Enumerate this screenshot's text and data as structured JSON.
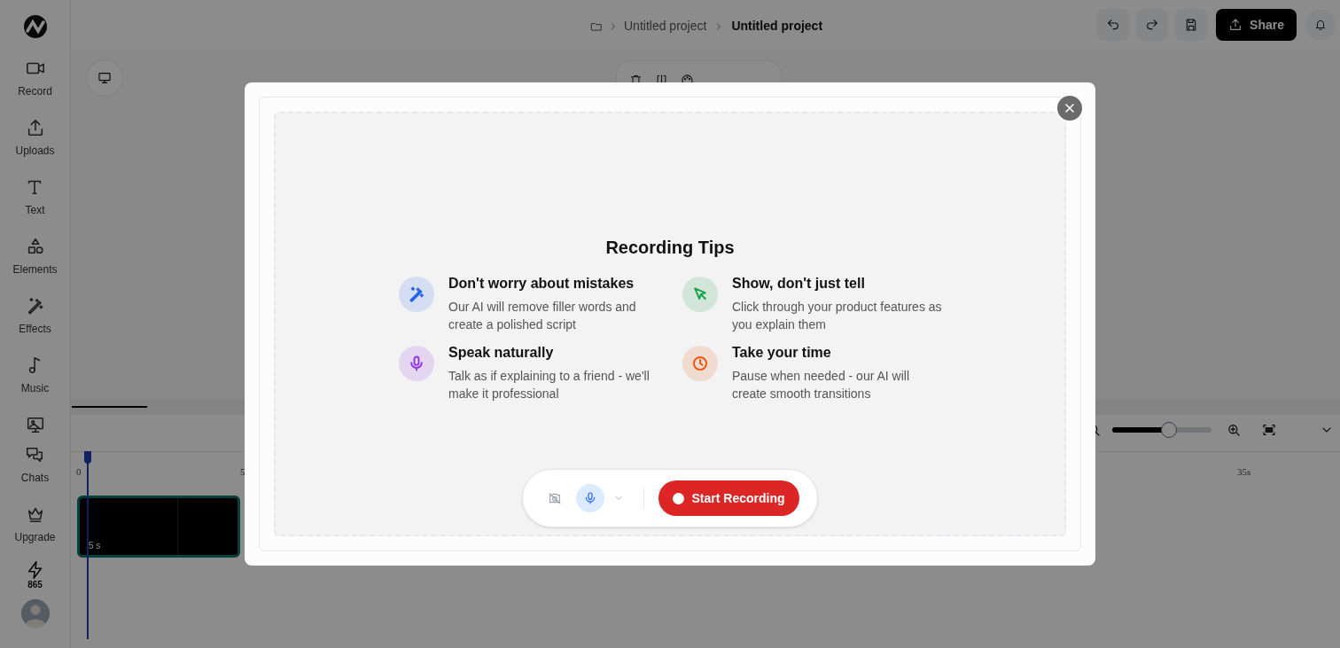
{
  "breadcrumb": [
    {
      "label": "Untitled project",
      "current": false
    },
    {
      "label": "Untitled project",
      "current": true
    }
  ],
  "share_button": "Share",
  "sidebar": {
    "items": [
      {
        "label": "Record"
      },
      {
        "label": "Uploads"
      },
      {
        "label": "Text"
      },
      {
        "label": "Elements"
      },
      {
        "label": "Effects"
      },
      {
        "label": "Music"
      },
      {
        "kind": "icon_only"
      },
      {
        "label": "Chats"
      },
      {
        "label": "Upgrade"
      }
    ],
    "credits": "865"
  },
  "timeline": {
    "zoom": {
      "level": 0.57
    },
    "ruler": [
      "0",
      "5",
      "35s"
    ],
    "clip": {
      "duration": "5 s"
    }
  },
  "modal": {
    "title": "Recording Tips",
    "tips": [
      {
        "title": "Don't worry about mistakes",
        "text": "Our AI will remove filler words and create a polished script",
        "color": "#2563eb"
      },
      {
        "title": "Show, don't just tell",
        "text": "Click through your product features as you explain them",
        "color": "#16a34a"
      },
      {
        "title": "Speak naturally",
        "text": "Talk as if explaining to a friend - we'll make it professional",
        "color": "#9333ea"
      },
      {
        "title": "Take your time",
        "text": "Pause when needed - our AI will create smooth transitions",
        "color": "#ea580c"
      }
    ],
    "camera": {
      "on": false
    },
    "microphone": {
      "on": true
    },
    "start_button": "Start Recording"
  }
}
